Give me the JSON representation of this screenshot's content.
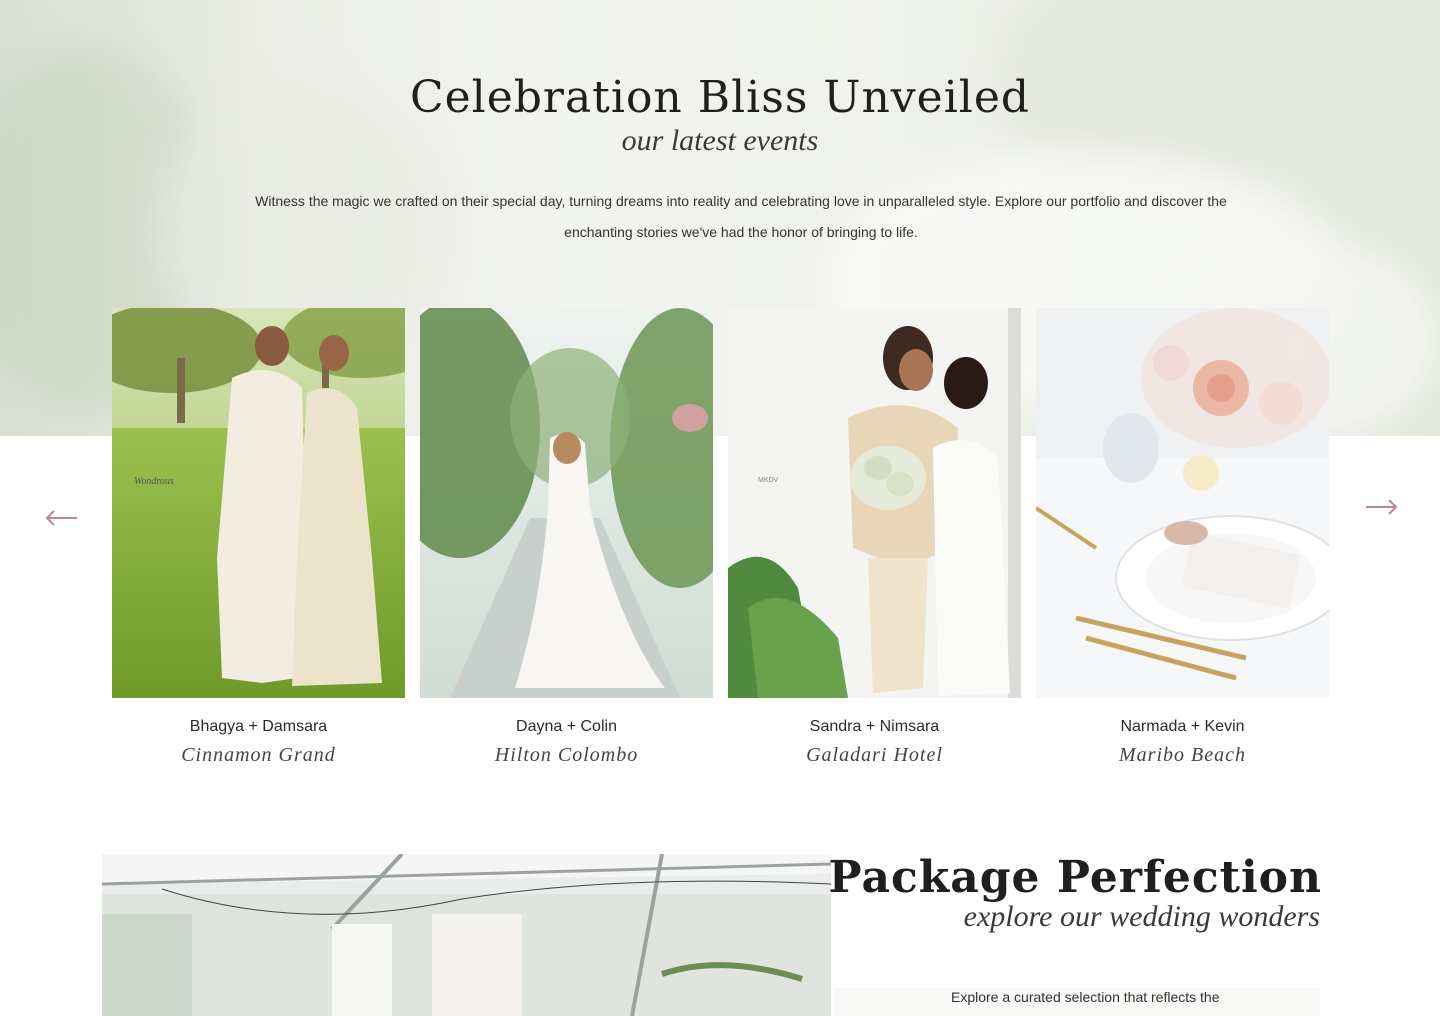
{
  "hero": {
    "title": "Celebration Bliss Unveiled",
    "subtitle": "our latest events",
    "description": "Witness the magic we crafted on their special day, turning dreams into reality and celebrating love in unparalleled style. Explore our portfolio and discover the enchanting stories we've had the honor of bringing to life."
  },
  "carousel": {
    "prev_icon": "arrow-left-icon",
    "next_icon": "arrow-right-icon",
    "accent_color": "#c0859a",
    "events": [
      {
        "names": "Bhagya + Damsara",
        "venue": "Cinnamon Grand",
        "watermark": "Wondrous"
      },
      {
        "names": "Dayna + Colin",
        "venue": "Hilton Colombo"
      },
      {
        "names": "Sandra + Nimsara",
        "venue": "Galadari Hotel",
        "watermark": "MKDV"
      },
      {
        "names": "Narmada + Kevin",
        "venue": "Maribo Beach"
      }
    ]
  },
  "package": {
    "title": "Package Perfection",
    "subtitle": "explore our wedding wonders",
    "description": "Explore a curated selection that reflects the"
  }
}
